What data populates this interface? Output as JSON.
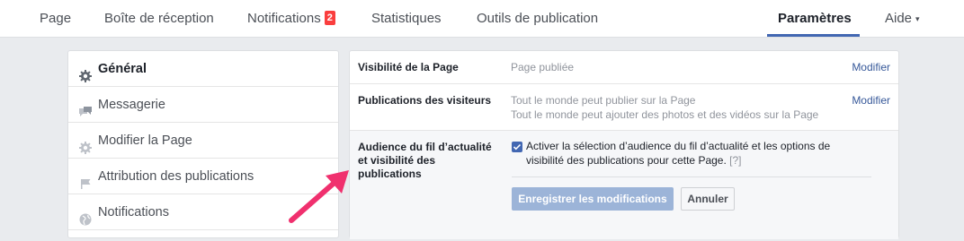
{
  "nav": {
    "items": [
      {
        "label": "Page"
      },
      {
        "label": "Boîte de réception"
      },
      {
        "label": "Notifications",
        "badge": "2"
      },
      {
        "label": "Statistiques"
      },
      {
        "label": "Outils de publication"
      },
      {
        "label": "Paramètres"
      },
      {
        "label": "Aide",
        "caret": "▾"
      }
    ],
    "active": "Paramètres"
  },
  "sidebar": {
    "items": [
      {
        "label": "Général",
        "icon": "gear-icon"
      },
      {
        "label": "Messagerie",
        "icon": "chat-bubbles-icon"
      },
      {
        "label": "Modifier la Page",
        "icon": "gear-icon"
      },
      {
        "label": "Attribution des publications",
        "icon": "flag-icon"
      },
      {
        "label": "Notifications",
        "icon": "globe-icon"
      }
    ]
  },
  "settings": {
    "visibility": {
      "label": "Visibilité de la Page",
      "value": "Page publiée",
      "edit": "Modifier"
    },
    "visitor_posts": {
      "label": "Publications des visiteurs",
      "value1": "Tout le monde peut publier sur la Page",
      "value2": "Tout le monde peut ajouter des photos et des vidéos sur la Page",
      "edit": "Modifier"
    },
    "audience": {
      "label": "Audience du fil d’actualité et visibilité des publications",
      "checkbox_text": "Activer la sélection d’audience du fil d’actualité et les options de visibilité des publications pour cette Page.",
      "help": "[?]",
      "checked": true,
      "save": "Enregistrer les modifications",
      "cancel": "Annuler"
    }
  },
  "colors": {
    "accent": "#4267b2",
    "badge": "#fa3e3e",
    "link": "#365899",
    "annotation_arrow": "#f0306e"
  }
}
